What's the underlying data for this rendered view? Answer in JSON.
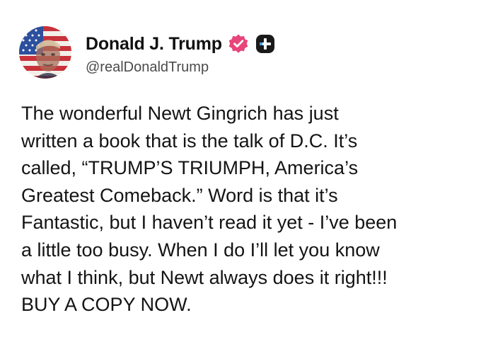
{
  "author": {
    "display_name": "Donald J. Trump",
    "handle": "@realDonaldTrump",
    "avatar_icon": "flag-portrait-avatar",
    "verified_icon": "verified-badge-icon",
    "plus_icon": "plus-badge-icon"
  },
  "colors": {
    "verified": "#e8457a",
    "plus_badge": "#1a1a1a",
    "text": "#141414",
    "handle": "#4a4a4a"
  },
  "post": {
    "lines": [
      "The wonderful Newt Gingrich has just",
      "written a book that is the talk of D.C. It’s",
      "called, “TRUMP’S TRIUMPH, America’s",
      "Greatest Comeback.” Word is that it’s",
      "Fantastic, but I haven’t read it yet - I’ve been",
      "a little too busy. When I do I’ll let you know",
      "what I think, but Newt always does it right!!!",
      "BUY A COPY NOW."
    ]
  }
}
